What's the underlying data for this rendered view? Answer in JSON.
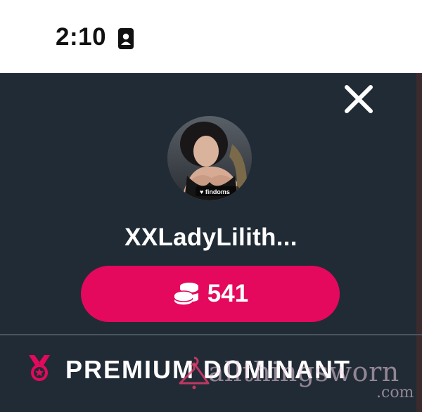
{
  "status_bar": {
    "time": "2:10",
    "icon": "contact-card-icon"
  },
  "profile": {
    "close_icon": "close-icon",
    "avatar_alt": "profile photo",
    "username": "XXLadyLilith...",
    "coins": {
      "icon": "coin-stack-icon",
      "count": "541"
    }
  },
  "badge": {
    "icon": "medal-icon",
    "label": "PREMIUM DOMINANT"
  },
  "watermark": {
    "text": "allthingsworn",
    "domain": ".com",
    "icon": "hanger-icon"
  },
  "colors": {
    "panel_bg": "#212b35",
    "accent": "#e4095d",
    "text": "#ffffff"
  }
}
